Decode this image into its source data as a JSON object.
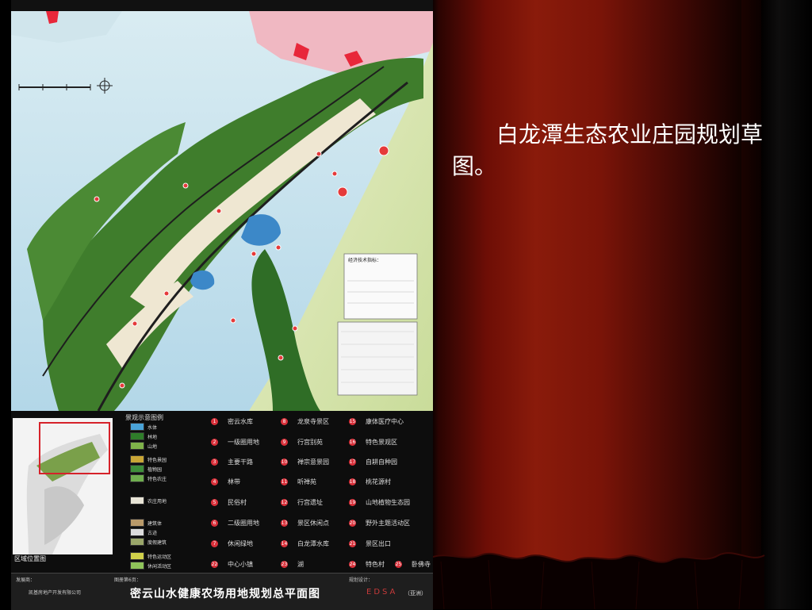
{
  "slide": {
    "text": "　　白龙潭生态农业庄园规划草图。"
  },
  "plan": {
    "title": "密云山水健康农场用地规划总平面图",
    "developer_label": "发展商：",
    "developer_name": "凯基房地产开发有限公司",
    "sheet_label": "图册第6页：",
    "designer_label": "规划设计：",
    "designer_name": "EDSA",
    "designer_suffix": "（亚洲）",
    "inset_label": "区域位置图",
    "legend_title": "景观示意图例",
    "swatches": [
      {
        "label": "水体",
        "color": "#4aa3d8"
      },
      {
        "label": "林地",
        "color": "#2f7d2a"
      },
      {
        "label": "山地",
        "color": "#7fb24a"
      },
      {
        "label": "特色景园",
        "color": "#c9a636"
      },
      {
        "label": "植物园",
        "color": "#3e8f3a"
      },
      {
        "label": "特色农庄",
        "color": "#6fae4e"
      },
      {
        "label": "农庄用地",
        "color": "#e8e4d6"
      },
      {
        "label": "建筑体",
        "color": "#b99a6a"
      },
      {
        "label": "古迹",
        "color": "#dddddd"
      },
      {
        "label": "度假建筑",
        "color": "#9aa66a"
      },
      {
        "label": "特色运动区",
        "color": "#cfd04a"
      },
      {
        "label": "休闲活动区",
        "color": "#8fc45a"
      }
    ],
    "legend_items": [
      {
        "num": "1",
        "label": "密云水库"
      },
      {
        "num": "8",
        "label": "龙泉寺景区"
      },
      {
        "num": "15",
        "label": "康体医疗中心"
      },
      {
        "num": "2",
        "label": "一级圈用地"
      },
      {
        "num": "9",
        "label": "行宫别苑"
      },
      {
        "num": "16",
        "label": "特色景观区"
      },
      {
        "num": "3",
        "label": "主要干路"
      },
      {
        "num": "10",
        "label": "禅宗意景园"
      },
      {
        "num": "17",
        "label": "自耕自种园"
      },
      {
        "num": "4",
        "label": "林带"
      },
      {
        "num": "11",
        "label": "听禅苑"
      },
      {
        "num": "18",
        "label": "桃花源村"
      },
      {
        "num": "5",
        "label": "民俗村"
      },
      {
        "num": "12",
        "label": "行宫遗址"
      },
      {
        "num": "19",
        "label": "山地植物生态园"
      },
      {
        "num": "6",
        "label": "二级圈用地"
      },
      {
        "num": "13",
        "label": "景区休闲点"
      },
      {
        "num": "20",
        "label": "野外主题活动区"
      },
      {
        "num": "7",
        "label": "休闲绿地"
      },
      {
        "num": "14",
        "label": "白龙潭水库"
      },
      {
        "num": "21",
        "label": "景区出口"
      },
      {
        "num": "22",
        "label": "中心小镇"
      },
      {
        "num": "23",
        "label": "湖"
      },
      {
        "num": "24",
        "label": "特色村"
      },
      {
        "num": "25",
        "label": "卧佛寺"
      }
    ],
    "map_labels": {
      "tech_title": "经济技术指标："
    }
  }
}
